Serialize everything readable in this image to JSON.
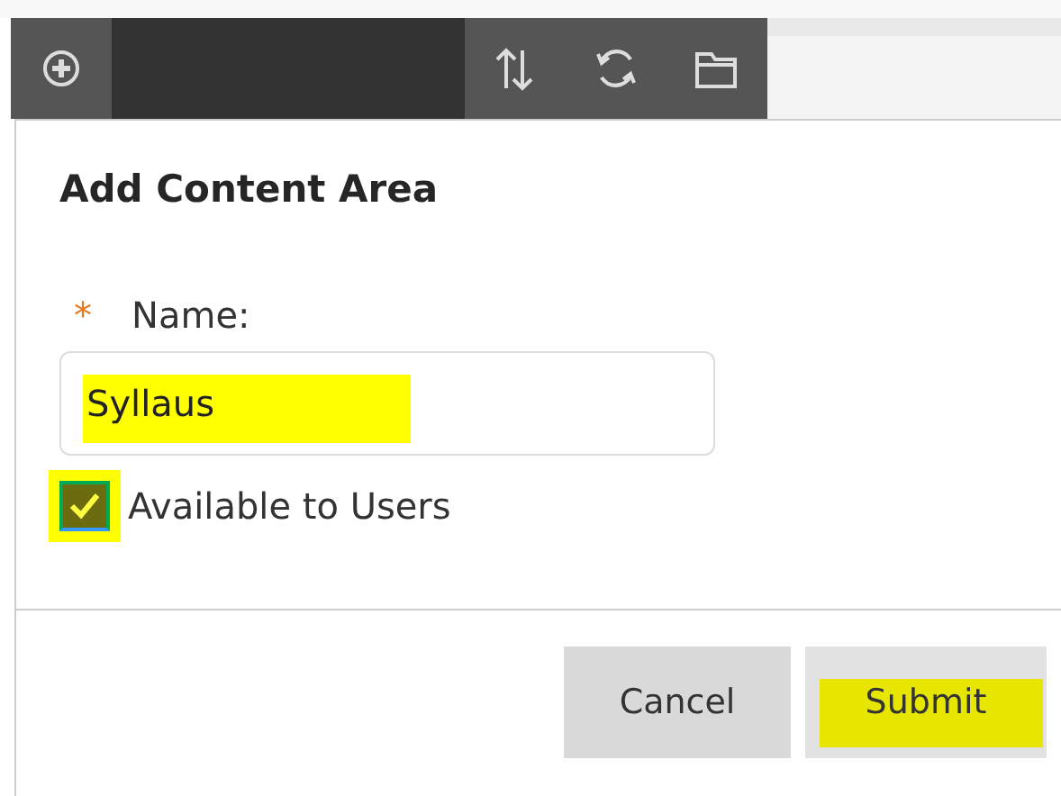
{
  "toolbar": {
    "buttons": [
      {
        "kind": "add"
      },
      {
        "kind": "sort"
      },
      {
        "kind": "refresh"
      },
      {
        "kind": "folder"
      }
    ]
  },
  "dialog": {
    "title": "Add Content Area",
    "name_field": {
      "label": "Name:",
      "required_mark": "*",
      "value": "Syllaus",
      "highlighted": true
    },
    "available": {
      "label": "Available to Users",
      "checked": true,
      "highlighted": true
    },
    "buttons": [
      {
        "label": "Cancel",
        "kind": "secondary",
        "highlighted": false
      },
      {
        "label": "Submit",
        "kind": "primary",
        "highlighted": true
      }
    ]
  }
}
